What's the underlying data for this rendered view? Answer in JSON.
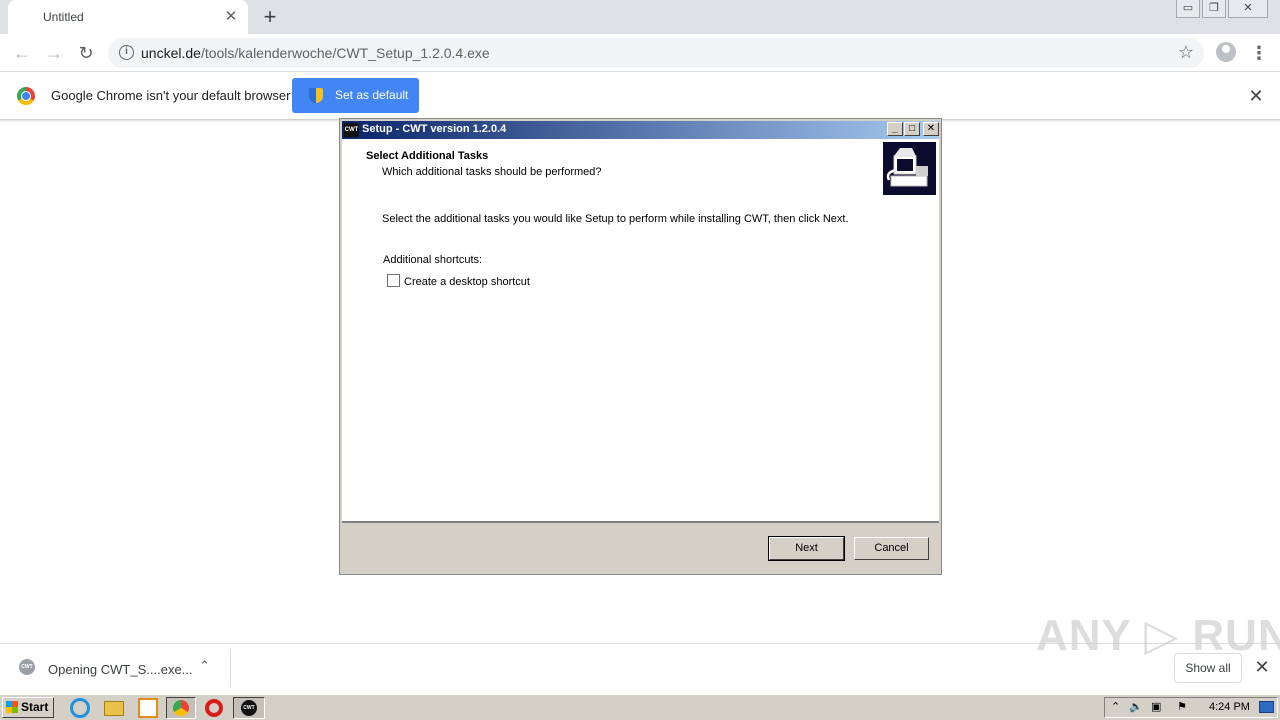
{
  "browser": {
    "tab": {
      "title": "Untitled",
      "close_glyph": "✕"
    },
    "new_tab_glyph": "+",
    "window_controls": {
      "minimize": "▭",
      "restore": "❐",
      "close": "✕"
    },
    "toolbar": {
      "url_host": "unckel.de",
      "url_path": "/tools/kalenderwoche/CWT_Setup_1.2.0.4.exe"
    },
    "infobar": {
      "message": "Google Chrome isn't your default browser",
      "button_label": "Set as default",
      "close_glyph": "✕"
    }
  },
  "dialog": {
    "title": "Setup - CWT version 1.2.0.4",
    "heading": "Select Additional Tasks",
    "subheading": "Which additional tasks should be performed?",
    "instruction": "Select the additional tasks you would like Setup to perform while installing CWT, then click Next.",
    "group_label": "Additional shortcuts:",
    "checkbox_label": "Create a desktop shortcut",
    "checkbox_checked": false,
    "buttons": {
      "next": "Next",
      "cancel": "Cancel"
    }
  },
  "downloads": {
    "item_text": "Opening CWT_S....exe...",
    "show_all": "Show all",
    "watermark": "ANY ▷ RUN"
  },
  "taskbar": {
    "start_label": "Start",
    "clock": "4:24 PM"
  },
  "colors": {
    "accent_blue": "#4285f4",
    "dialog_title_start": "#0a246a",
    "dialog_face": "#d4d0c8"
  }
}
